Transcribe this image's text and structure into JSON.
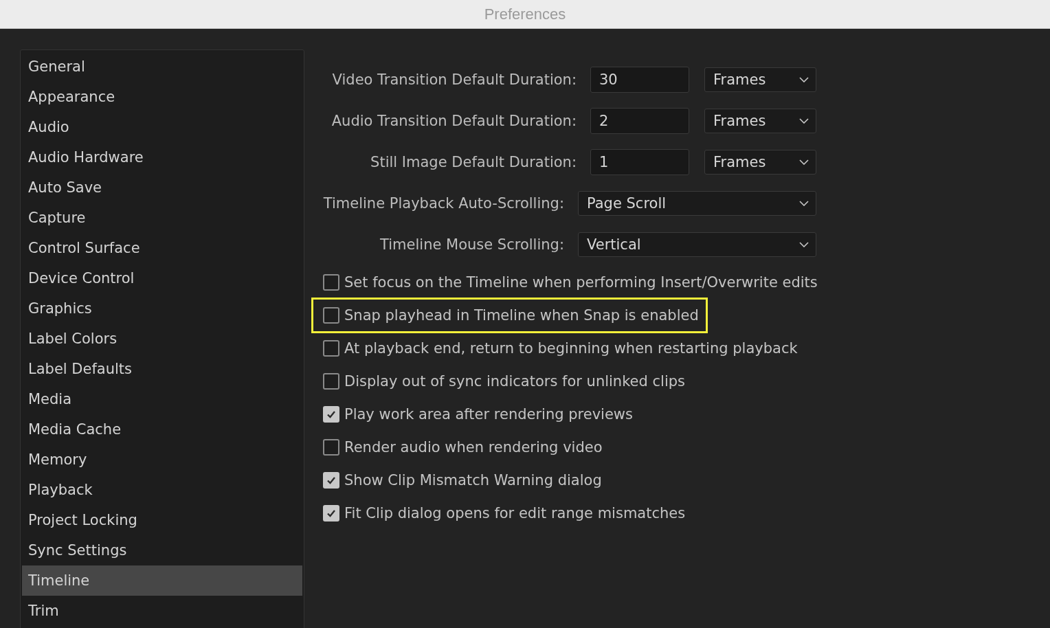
{
  "window": {
    "title": "Preferences"
  },
  "sidebar": {
    "items": [
      {
        "label": "General",
        "selected": false
      },
      {
        "label": "Appearance",
        "selected": false
      },
      {
        "label": "Audio",
        "selected": false
      },
      {
        "label": "Audio Hardware",
        "selected": false
      },
      {
        "label": "Auto Save",
        "selected": false
      },
      {
        "label": "Capture",
        "selected": false
      },
      {
        "label": "Control Surface",
        "selected": false
      },
      {
        "label": "Device Control",
        "selected": false
      },
      {
        "label": "Graphics",
        "selected": false
      },
      {
        "label": "Label Colors",
        "selected": false
      },
      {
        "label": "Label Defaults",
        "selected": false
      },
      {
        "label": "Media",
        "selected": false
      },
      {
        "label": "Media Cache",
        "selected": false
      },
      {
        "label": "Memory",
        "selected": false
      },
      {
        "label": "Playback",
        "selected": false
      },
      {
        "label": "Project Locking",
        "selected": false
      },
      {
        "label": "Sync Settings",
        "selected": false
      },
      {
        "label": "Timeline",
        "selected": true
      },
      {
        "label": "Trim",
        "selected": false
      }
    ]
  },
  "settings": [
    {
      "kind": "duration",
      "label": "Video Transition Default Duration:",
      "value": "30",
      "unit": "Frames"
    },
    {
      "kind": "duration",
      "label": "Audio Transition Default Duration:",
      "value": "2",
      "unit": "Frames"
    },
    {
      "kind": "duration",
      "label": "Still Image Default Duration:",
      "value": "1",
      "unit": "Frames"
    },
    {
      "kind": "select",
      "label": "Timeline Playback Auto-Scrolling:",
      "value": "Page Scroll"
    },
    {
      "kind": "select",
      "label": "Timeline Mouse Scrolling:",
      "value": "Vertical"
    }
  ],
  "options": [
    {
      "label": "Set focus on the Timeline when performing Insert/Overwrite edits",
      "checked": false,
      "highlighted": false
    },
    {
      "label": "Snap playhead in Timeline when Snap is enabled",
      "checked": false,
      "highlighted": true
    },
    {
      "label": "At playback end, return to beginning when restarting playback",
      "checked": false,
      "highlighted": false
    },
    {
      "label": "Display out of sync indicators for unlinked clips",
      "checked": false,
      "highlighted": false
    },
    {
      "label": "Play work area after rendering previews",
      "checked": true,
      "highlighted": false
    },
    {
      "label": "Render audio when rendering video",
      "checked": false,
      "highlighted": false
    },
    {
      "label": "Show Clip Mismatch Warning dialog",
      "checked": true,
      "highlighted": false
    },
    {
      "label": "Fit Clip dialog opens for edit range mismatches",
      "checked": true,
      "highlighted": false
    }
  ]
}
